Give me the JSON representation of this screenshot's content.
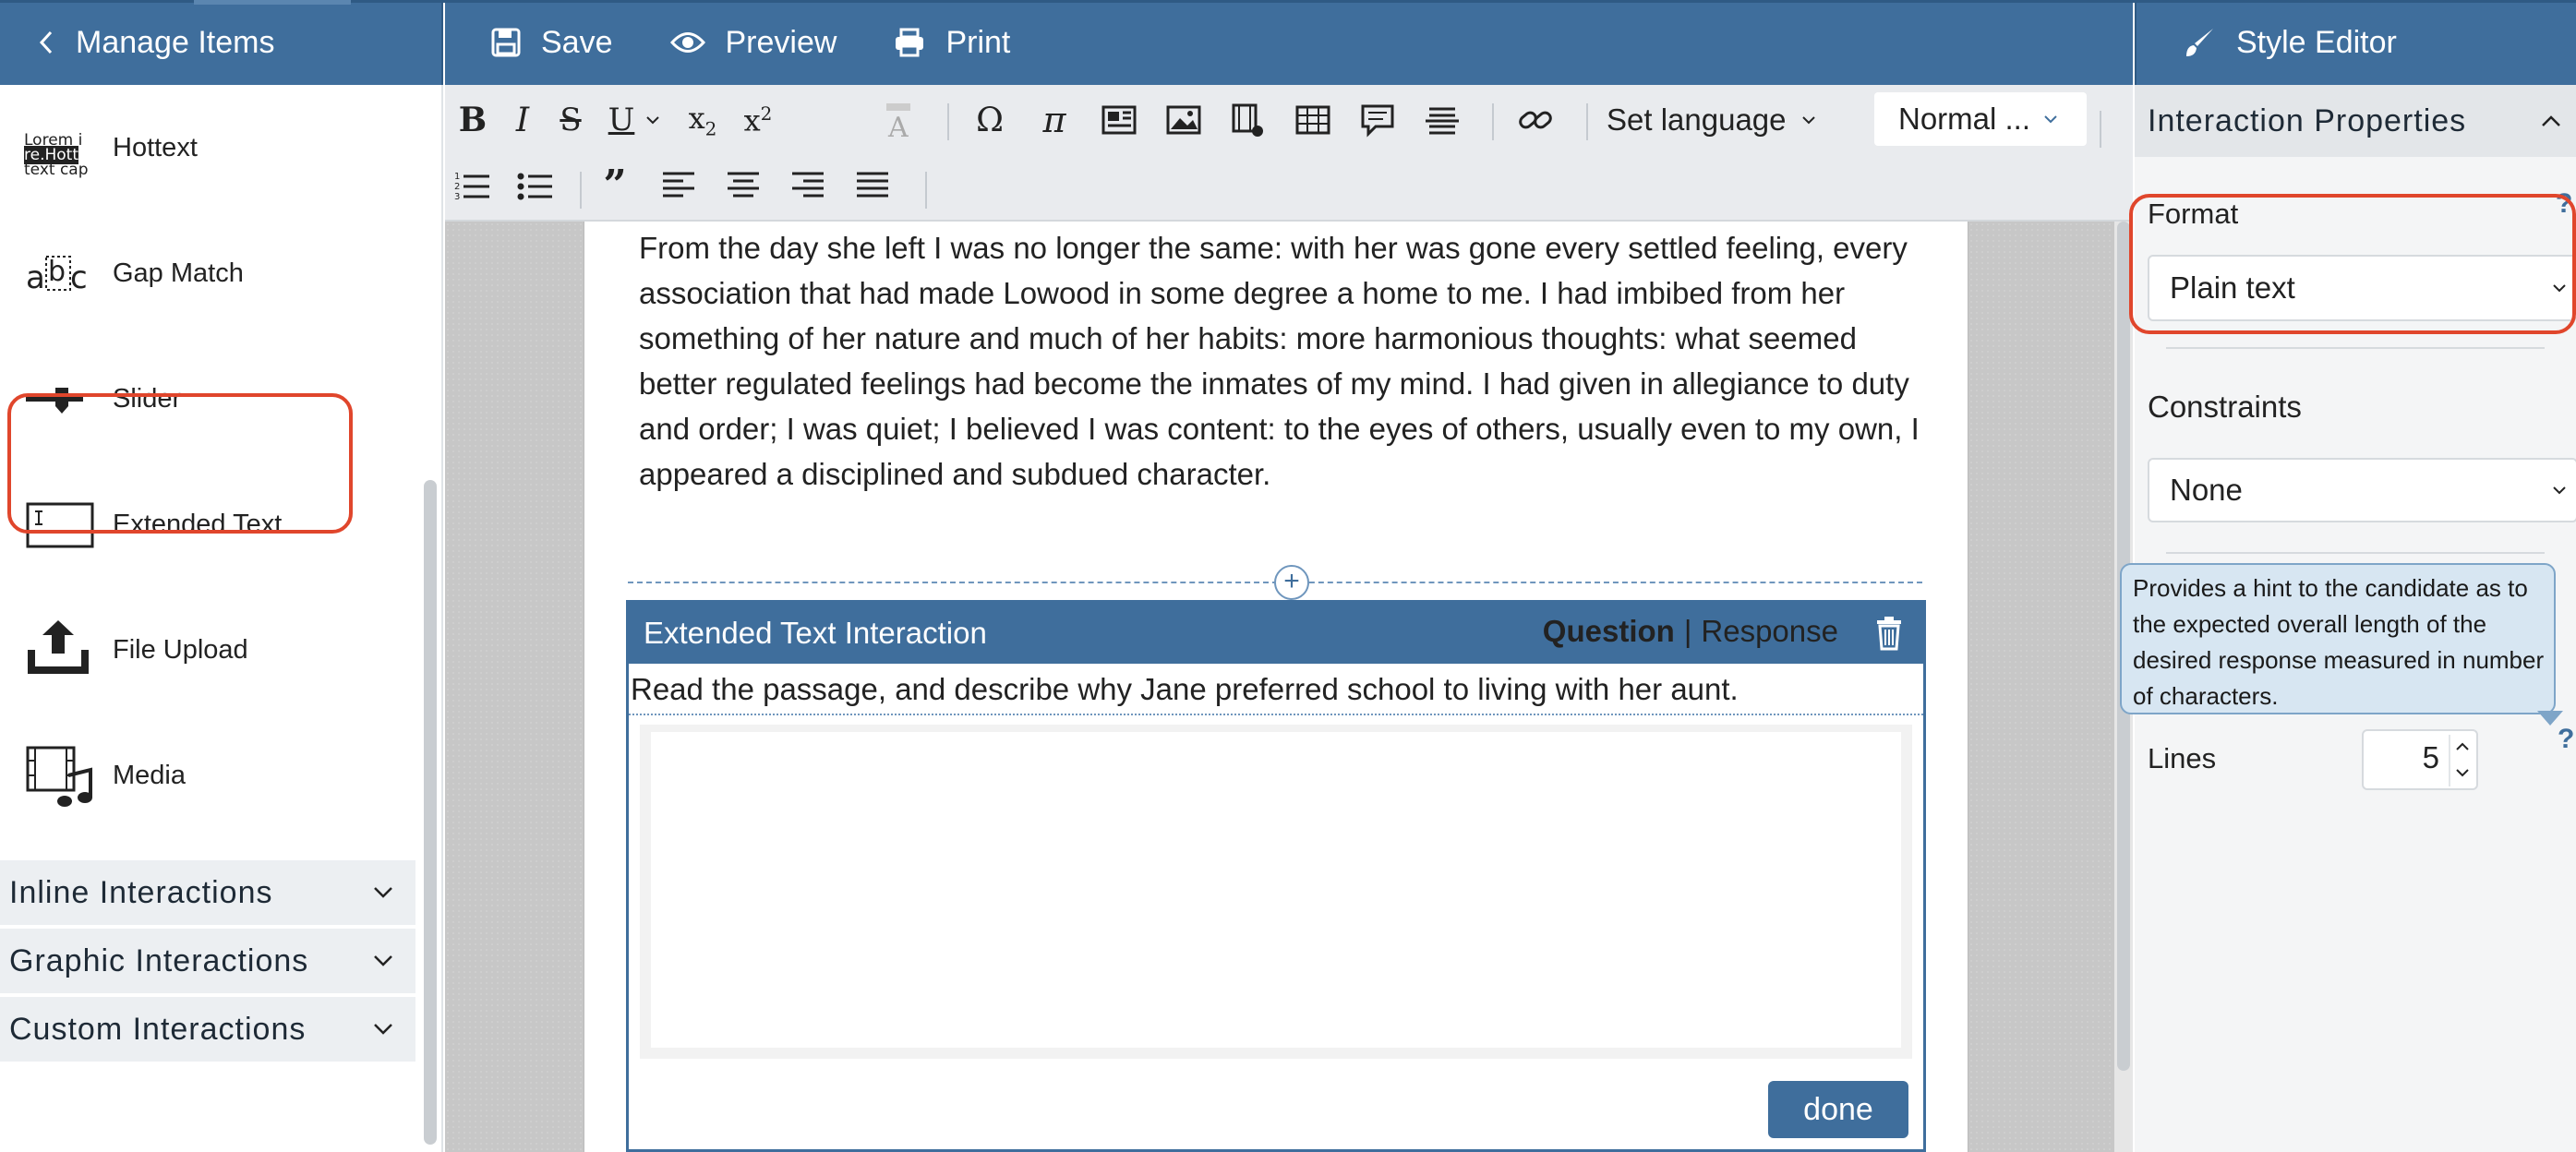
{
  "header": {
    "manage_items": "Manage Items",
    "save": "Save",
    "preview": "Preview",
    "print": "Print",
    "style_editor": "Style Editor"
  },
  "sidebar": {
    "items": [
      {
        "label": "Hottext",
        "icon": "hottext-icon",
        "icon_text": [
          "Lorem i",
          "re.Hott",
          "text cap"
        ]
      },
      {
        "label": "Gap Match",
        "icon": "gap-match-icon"
      },
      {
        "label": "Slider",
        "icon": "slider-icon"
      },
      {
        "label": "Extended Text",
        "icon": "extended-text-icon",
        "highlighted": true
      },
      {
        "label": "File Upload",
        "icon": "file-upload-icon"
      },
      {
        "label": "Media",
        "icon": "media-icon"
      }
    ],
    "groups": [
      {
        "label": "Inline Interactions"
      },
      {
        "label": "Graphic Interactions"
      },
      {
        "label": "Custom Interactions"
      }
    ]
  },
  "toolbar": {
    "set_language": "Set language",
    "style_select": "Normal ..."
  },
  "passage": "From the day she left I was no longer the same: with her was gone every settled feeling, every association that had made Lowood in some degree a home to me. I had imbibed from her something of her nature and much of her habits: more harmonious thoughts: what seemed better regulated feelings had become the inmates of my mind. I had given in allegiance to duty and order; I was quiet; I believed I was content: to the eyes of others, usually even to my own, I appeared a disciplined and subdued character.",
  "interaction": {
    "title": "Extended Text Interaction",
    "question": "Question",
    "separator": "|",
    "response": "Response",
    "prompt": "Read the passage, and describe why Jane preferred school to living with her aunt.",
    "done": "done"
  },
  "properties": {
    "section_title": "Interaction Properties",
    "format_label": "Format",
    "format_value": "Plain text",
    "constraints_label": "Constraints",
    "constraints_value": "None",
    "tooltip": "Provides a hint to the candidate as to the expected overall length of the desired response measured in number of characters.",
    "lines_label": "Lines",
    "lines_value": "5",
    "help": "?"
  },
  "colors": {
    "header_blue": "#3f6e9c",
    "highlight_red": "#e0462c",
    "tooltip_bg": "#d7e6f2"
  }
}
